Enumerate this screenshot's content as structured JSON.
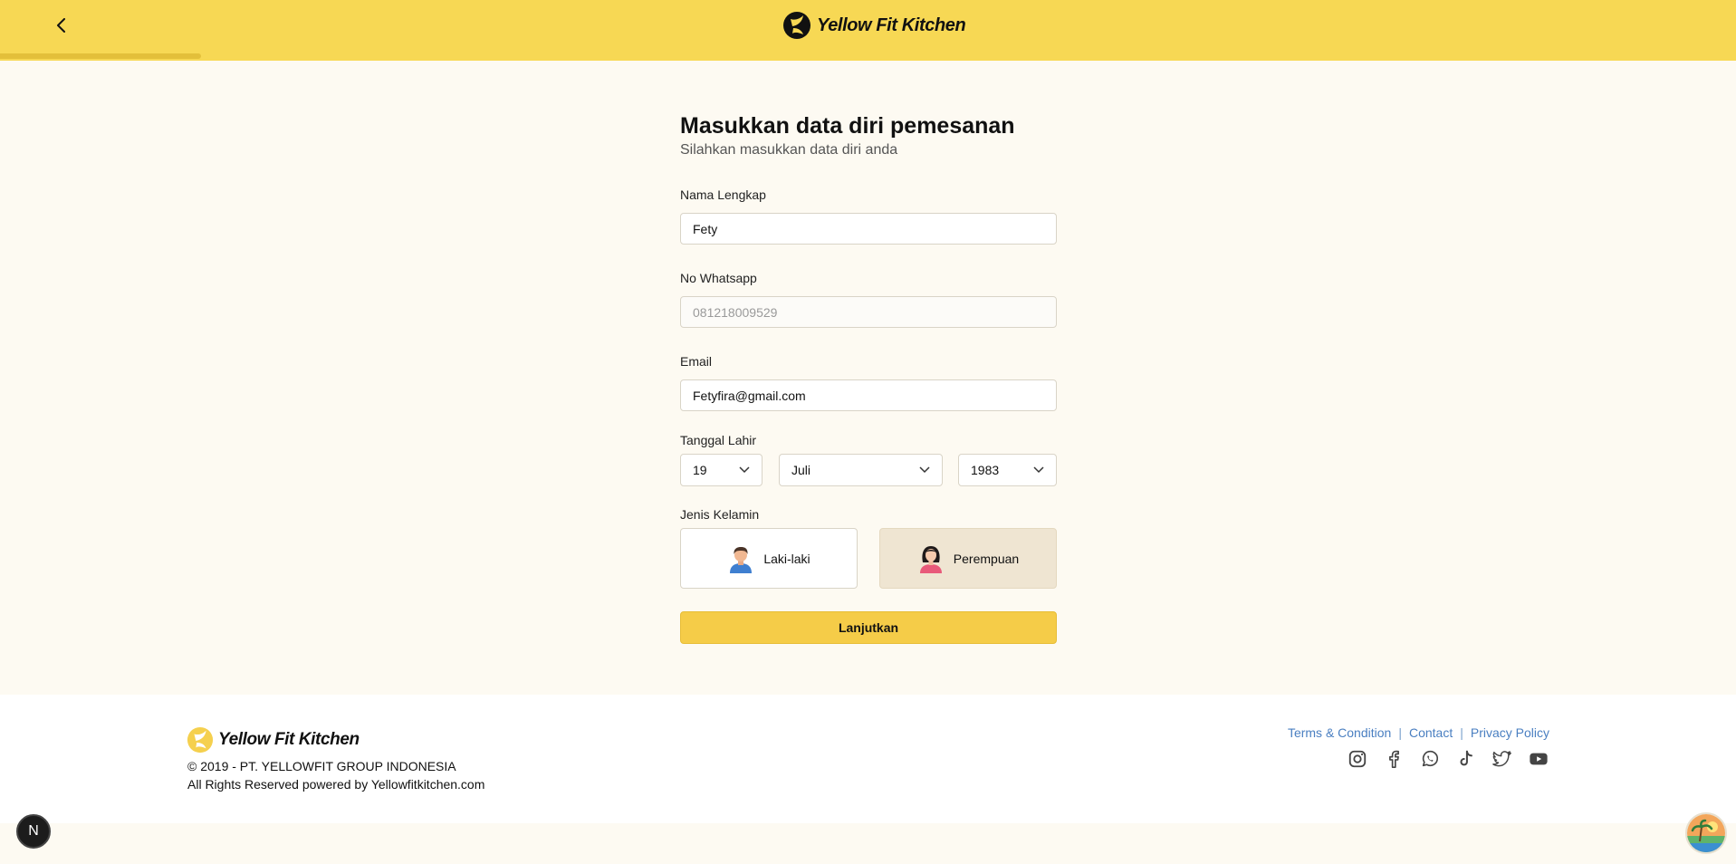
{
  "header": {
    "brand": "Yellow Fit Kitchen",
    "progress_fraction": 0.116
  },
  "form": {
    "title": "Masukkan data diri pemesanan",
    "subtitle": "Silahkan masukkan data diri anda",
    "name": {
      "label": "Nama Lengkap",
      "value": "Fety"
    },
    "whatsapp": {
      "label": "No Whatsapp",
      "value": "",
      "placeholder": "081218009529"
    },
    "email": {
      "label": "Email",
      "value": "Fetyfira@gmail.com"
    },
    "birthdate": {
      "label": "Tanggal Lahir",
      "day": "19",
      "month": "Juli",
      "year": "1983"
    },
    "gender": {
      "label": "Jenis Kelamin",
      "male": "Laki-laki",
      "female": "Perempuan",
      "selected": "female"
    },
    "submit": "Lanjutkan"
  },
  "footer": {
    "brand": "Yellow Fit Kitchen",
    "copyright": "© 2019 - PT. YELLOWFIT GROUP INDONESIA",
    "rights": "All Rights Reserved powered by Yellowfitkitchen.com",
    "links": [
      "Terms & Condition",
      "Contact",
      "Privacy Policy"
    ],
    "separator": "|",
    "socials": [
      "instagram-icon",
      "facebook-icon",
      "whatsapp-icon",
      "tiktok-icon",
      "twitter-icon",
      "youtube-icon"
    ]
  },
  "floating": {
    "n_badge": "N"
  },
  "colors": {
    "header": "#f7d854",
    "page": "#fdfaf2",
    "button": "#f5cc48",
    "link": "#4a7fc1",
    "selected": "#efe5d2"
  }
}
